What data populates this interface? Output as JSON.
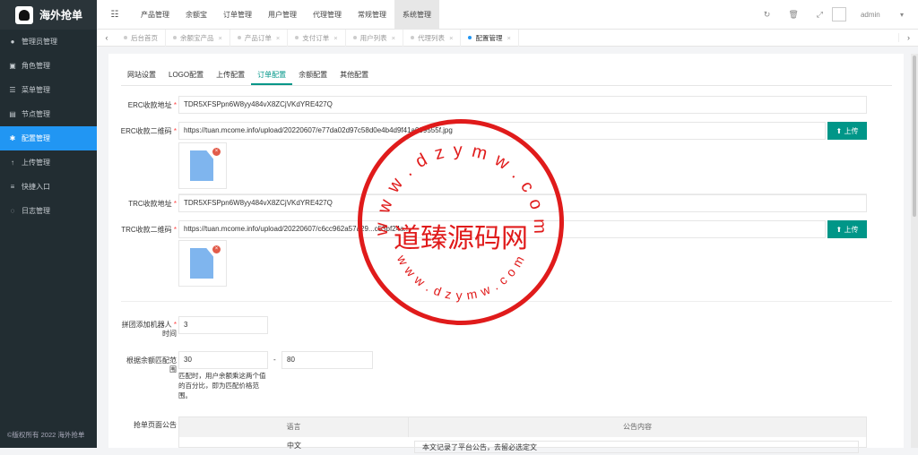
{
  "app": {
    "title": "海外抢单",
    "footer": "©版权所有 2022 海外抢单"
  },
  "sidebar": {
    "items": [
      {
        "label": "管理员管理",
        "icon": "user-icon"
      },
      {
        "label": "角色管理",
        "icon": "role-icon"
      },
      {
        "label": "菜单管理",
        "icon": "menu-icon"
      },
      {
        "label": "节点管理",
        "icon": "node-icon"
      },
      {
        "label": "配置管理",
        "icon": "gear-icon",
        "active": true
      },
      {
        "label": "上传管理",
        "icon": "upload-icon"
      },
      {
        "label": "快捷入口",
        "icon": "list-icon"
      },
      {
        "label": "日志管理",
        "icon": "log-icon"
      }
    ]
  },
  "topnav": {
    "items": [
      "产品管理",
      "余额宝",
      "订单管理",
      "用户管理",
      "代理管理",
      "常规管理",
      "系统管理"
    ],
    "active": 6
  },
  "topright": {
    "user": "admin"
  },
  "tabs": [
    {
      "label": "后台首页"
    },
    {
      "label": "余额宝产品"
    },
    {
      "label": "产品订单"
    },
    {
      "label": "支付订单"
    },
    {
      "label": "用户列表"
    },
    {
      "label": "代理列表"
    },
    {
      "label": "配置管理",
      "active": true
    }
  ],
  "subtabs": {
    "items": [
      "网站设置",
      "LOGO配置",
      "上传配置",
      "订单配置",
      "余额配置",
      "其他配置"
    ],
    "active": 3
  },
  "form": {
    "erc_address_label": "ERC收款地址",
    "erc_address_value": "TDR5XFSPpn6W8yy484vX8ZCjVKdYRE427Q",
    "erc_qr_label": "ERC收款二维码",
    "erc_qr_value": "https://tuan.mcome.info/upload/20220607/e77da02d97c58d0e4b4d9f41a099555f.jpg",
    "trc_address_label": "TRC收款地址",
    "trc_address_value": "TDR5XFSPpn6W8yy484vX8ZCjVKdYRE427Q",
    "trc_qr_label": "TRC收款二维码",
    "trc_qr_value": "https://tuan.mcome.info/upload/20220607/c6cc962a57a29...c53bf24a...",
    "upload_label": "上传",
    "robot_label_1": "拼团添加机器人",
    "robot_label_2": "时间",
    "robot_value": "3",
    "range_label_1": "根据余额匹配范",
    "range_label_2": "围",
    "range_min": "30",
    "range_dash": "-",
    "range_max": "80",
    "range_help": "匹配时，用户余额乘这两个值的百分比，即为匹配价格范围。",
    "notice_label": "抢单页面公告",
    "notice_col_lang": "语言",
    "notice_col_content": "公告内容",
    "notice_row_lang": "中文",
    "notice_row_content": "本文记录了平台公告，去留必选定文"
  },
  "stamp": {
    "center_text": "道臻源码网",
    "top_text": "w w w . d z y m w . c o m",
    "bottom_text": "w w w . d z y m w . c o m",
    "color": "#e01b1b"
  }
}
